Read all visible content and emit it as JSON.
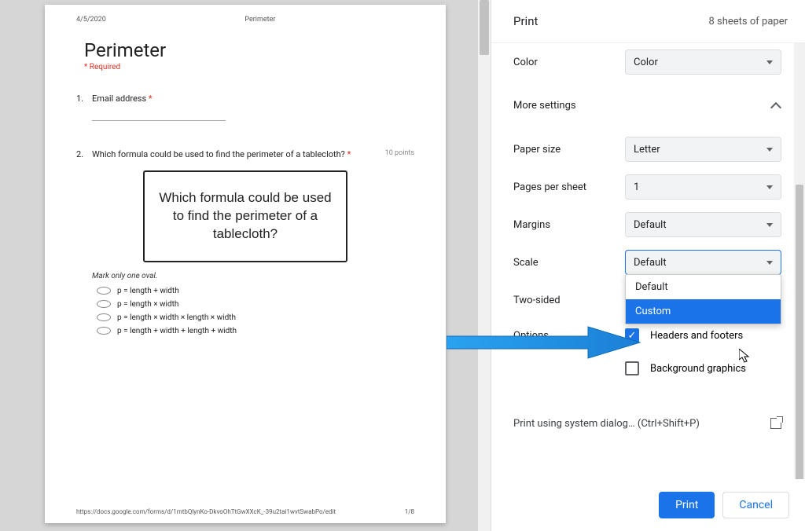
{
  "preview": {
    "date": "4/5/2020",
    "header_title": "Perimeter",
    "title": "Perimeter",
    "required_label": "* Required",
    "q1": {
      "num": "1.",
      "text": "Email address",
      "star": "*"
    },
    "q2": {
      "num": "2.",
      "text": "Which formula could be used to find the perimeter of a tablecloth?",
      "star": "*",
      "points": "10 points"
    },
    "box_text": "Which formula could be used to find the perimeter of a tablecloth?",
    "mark_hint": "Mark only one oval.",
    "options": [
      "p = length + width",
      "p = length × width",
      "p = length × width × length × width",
      "p = length + width + length + width"
    ],
    "footer_url": "https://docs.google.com/forms/d/1mtbQlynKo-DkvoOhTtGwXXcK_-39u2tai1wvtSwabPo/edit",
    "page_num": "1/8"
  },
  "print": {
    "title": "Print",
    "sheet_count": "8 sheets of paper",
    "color_label": "Color",
    "color_value": "Color",
    "more_settings": "More settings",
    "paper_size_label": "Paper size",
    "paper_size_value": "Letter",
    "pages_per_sheet_label": "Pages per sheet",
    "pages_per_sheet_value": "1",
    "margins_label": "Margins",
    "margins_value": "Default",
    "scale_label": "Scale",
    "scale_value": "Default",
    "scale_options": [
      "Default",
      "Custom"
    ],
    "two_sided_label": "Two-sided",
    "options_label": "Options",
    "headers_footers": "Headers and footers",
    "background_graphics": "Background graphics",
    "system_dialog": "Print using system dialog… (Ctrl+Shift+P)",
    "print_button": "Print",
    "cancel_button": "Cancel"
  }
}
